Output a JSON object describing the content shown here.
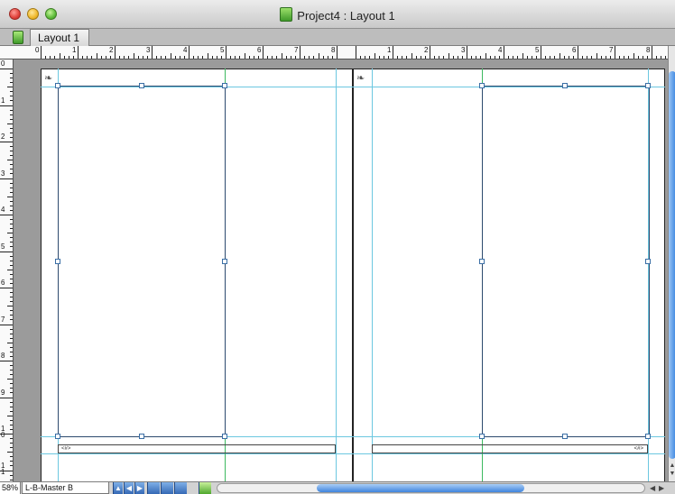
{
  "window": {
    "title": "Project4 : Layout 1"
  },
  "tabs": [
    {
      "label": "Layout 1"
    }
  ],
  "ruler": {
    "horizontal_labels": [
      "0",
      "1",
      "2",
      "3",
      "4",
      "5",
      "6",
      "7",
      "8",
      "1",
      "2",
      "3",
      "4",
      "5",
      "6",
      "7",
      "8"
    ],
    "vertical_labels": [
      "0",
      "1",
      "2",
      "3",
      "4",
      "5",
      "6",
      "7",
      "8",
      "9",
      "10",
      "11"
    ]
  },
  "pages": [
    {
      "footer_text": "<#>"
    },
    {
      "footer_text": "<#>"
    }
  ],
  "status": {
    "zoom": "58%",
    "master_page": "L-B-Master B"
  },
  "icons": {
    "link": "❧",
    "up": "▲",
    "left": "◀",
    "right": "▶",
    "down": "▼"
  },
  "colors": {
    "guide_cyan": "#6cc7e0",
    "guide_green": "#3cb95f",
    "frame": "#2d4a6e",
    "handle": "#3a6ea5"
  }
}
